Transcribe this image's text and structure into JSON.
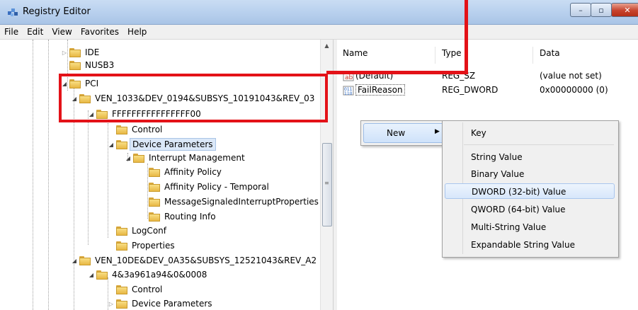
{
  "window": {
    "title": "Registry Editor",
    "controls": [
      "–",
      "▫",
      "✕"
    ]
  },
  "menu": [
    "File",
    "Edit",
    "View",
    "Favorites",
    "Help"
  ],
  "tree": {
    "nodes": [
      {
        "label": "IDE"
      },
      {
        "label": "NUSB3"
      },
      {
        "label": "PCI"
      },
      {
        "label": "VEN_1033&DEV_0194&SUBSYS_10191043&REV_03"
      },
      {
        "label": "FFFFFFFFFFFFFFFF00"
      },
      {
        "label": "Control"
      },
      {
        "label": "Device Parameters"
      },
      {
        "label": "Interrupt Management"
      },
      {
        "label": "Affinity Policy"
      },
      {
        "label": "Affinity Policy - Temporal"
      },
      {
        "label": "MessageSignaledInterruptProperties"
      },
      {
        "label": "Routing Info"
      },
      {
        "label": "LogConf"
      },
      {
        "label": "Properties"
      },
      {
        "label": "VEN_10DE&DEV_0A35&SUBSYS_12521043&REV_A2"
      },
      {
        "label": "4&3a961a94&0&0008"
      },
      {
        "label": "Control"
      },
      {
        "label": "Device Parameters"
      }
    ]
  },
  "values": {
    "columns": [
      "Name",
      "Type",
      "Data"
    ],
    "rows": [
      {
        "name": "(Default)",
        "type": "REG_SZ",
        "data": "(value not set)"
      },
      {
        "name": "FailReason",
        "type": "REG_DWORD",
        "data": "0x00000000 (0)"
      }
    ]
  },
  "context_menu": {
    "new_label": "New",
    "new_arrow": "▶",
    "submenu": [
      "Key",
      "String Value",
      "Binary Value",
      "DWORD (32-bit) Value",
      "QWORD (64-bit) Value",
      "Multi-String Value",
      "Expandable String Value"
    ]
  },
  "colors": {
    "annotation_red": "#e31218",
    "selection": "#dbe8f8"
  }
}
